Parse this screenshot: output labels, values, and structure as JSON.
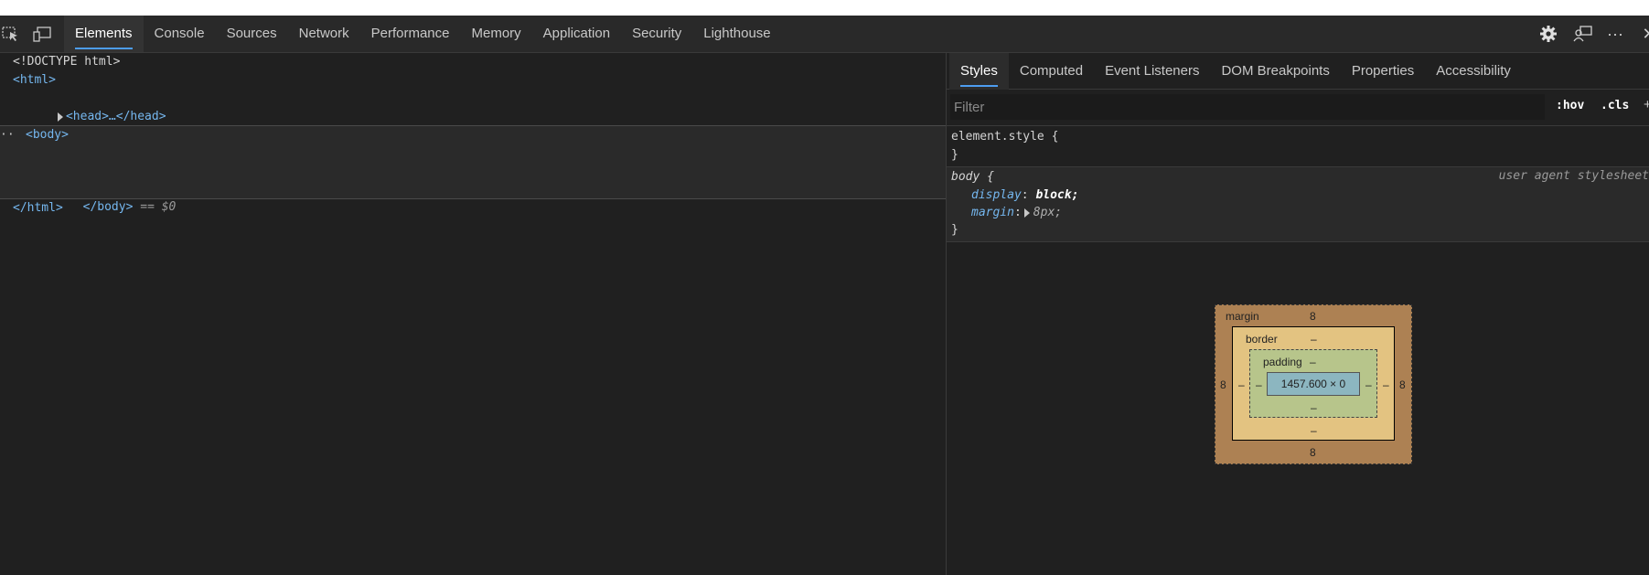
{
  "toolbar": {
    "inspect_icon": "inspect-element-icon",
    "device_icon": "device-emulation-icon",
    "tabs": [
      "Elements",
      "Console",
      "Sources",
      "Network",
      "Performance",
      "Memory",
      "Application",
      "Security",
      "Lighthouse"
    ],
    "active_tab": "Elements",
    "right_icons": [
      "settings-gear-icon",
      "feedback-icon",
      "more-options-icon",
      "close-icon"
    ],
    "more_glyph": "···",
    "close_glyph": "✕"
  },
  "dom": {
    "doctype": "<!DOCTYPE html>",
    "html_open": "<html>",
    "head": "<head>…</head>",
    "body_open": "<body>",
    "body_close": "</body>",
    "selected_marker": "== $0",
    "html_close": "</html>",
    "dots": "··"
  },
  "styles": {
    "subtabs": [
      "Styles",
      "Computed",
      "Event Listeners",
      "DOM Breakpoints",
      "Properties",
      "Accessibility"
    ],
    "active_subtab": "Styles",
    "filter_placeholder": "Filter",
    "hov": ":hov",
    "cls": ".cls",
    "plus": "+",
    "element_style_selector": "element.style {",
    "close_brace": "}",
    "body_selector": "body",
    "open_brace": "{",
    "ua_label": "user agent stylesheet",
    "decl1_prop": "display",
    "decl1_val": "block;",
    "decl2_prop": "margin",
    "decl2_val": "8px;",
    "colon": ":"
  },
  "box_model": {
    "margin_label": "margin",
    "margin_top": "8",
    "margin_bottom": "8",
    "margin_left": "8",
    "margin_right": "8",
    "border_label": "border",
    "border_top": "–",
    "border_bottom": "–",
    "border_left": "–",
    "border_right": "–",
    "padding_label": "padding",
    "padding_top": "–",
    "padding_bottom": "–",
    "padding_left": "–",
    "padding_right": "–",
    "content_size": "1457.600 × 0"
  },
  "colors": {
    "accent": "#4d9df0",
    "panel_bg": "#202020",
    "margin": "#ad8153",
    "border": "#e3c381",
    "padding": "#b7c58b",
    "content": "#8cb6c0"
  }
}
